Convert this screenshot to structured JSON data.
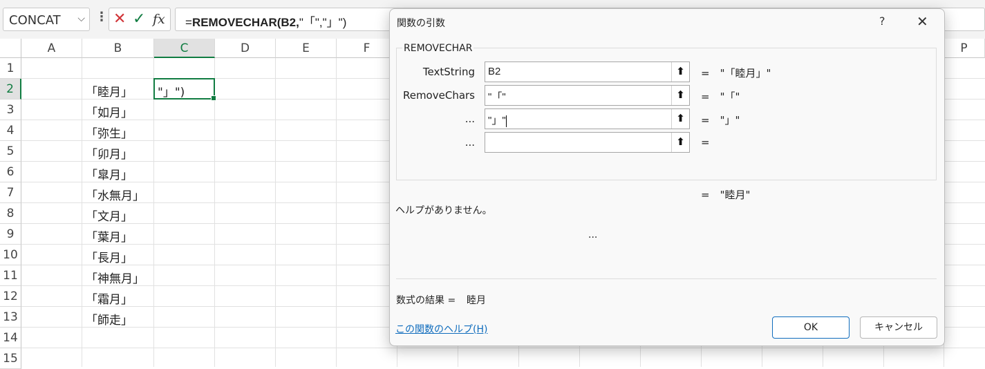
{
  "namebox": {
    "value": "CONCAT"
  },
  "formula_bar": {
    "prefix": "=",
    "bold": "REMOVECHAR",
    "rest_bold": "(B2,",
    "rest": "\"「\",\"」\")"
  },
  "columns": [
    "A",
    "B",
    "C",
    "D",
    "E",
    "F",
    "P"
  ],
  "rows": [
    "1",
    "2",
    "3",
    "4",
    "5",
    "6",
    "7",
    "8",
    "9",
    "10",
    "11",
    "12",
    "13",
    "14",
    "15"
  ],
  "cells": {
    "b": [
      "「睦月」",
      "「如月」",
      "「弥生」",
      "「卯月」",
      "「皐月」",
      "「水無月」",
      "「文月」",
      "「葉月」",
      "「長月」",
      "「神無月」",
      "「霜月」",
      "「師走」"
    ],
    "c2": "\"」\")"
  },
  "dialog": {
    "title": "関数の引数",
    "help_glyph": "?",
    "close_glyph": "✕",
    "function_name": "REMOVECHAR",
    "args": [
      {
        "label": "TextString",
        "value": "B2",
        "result": "=　\"「睦月」\""
      },
      {
        "label": "RemoveChars",
        "value": "\"「\"",
        "result": "=　\"「\""
      },
      {
        "label": "...",
        "value": "\"」\"",
        "result": "=　\"」\""
      },
      {
        "label": "...",
        "value": "",
        "result": "="
      }
    ],
    "overall_result": "=　\"睦月\"",
    "no_help": "ヘルプがありません。",
    "ellipsis": "...",
    "formula_result_label": "数式の結果 =",
    "formula_result_value": "睦月",
    "help_link": "この関数のヘルプ(H)",
    "ok": "OK",
    "cancel": "キャンセル"
  }
}
